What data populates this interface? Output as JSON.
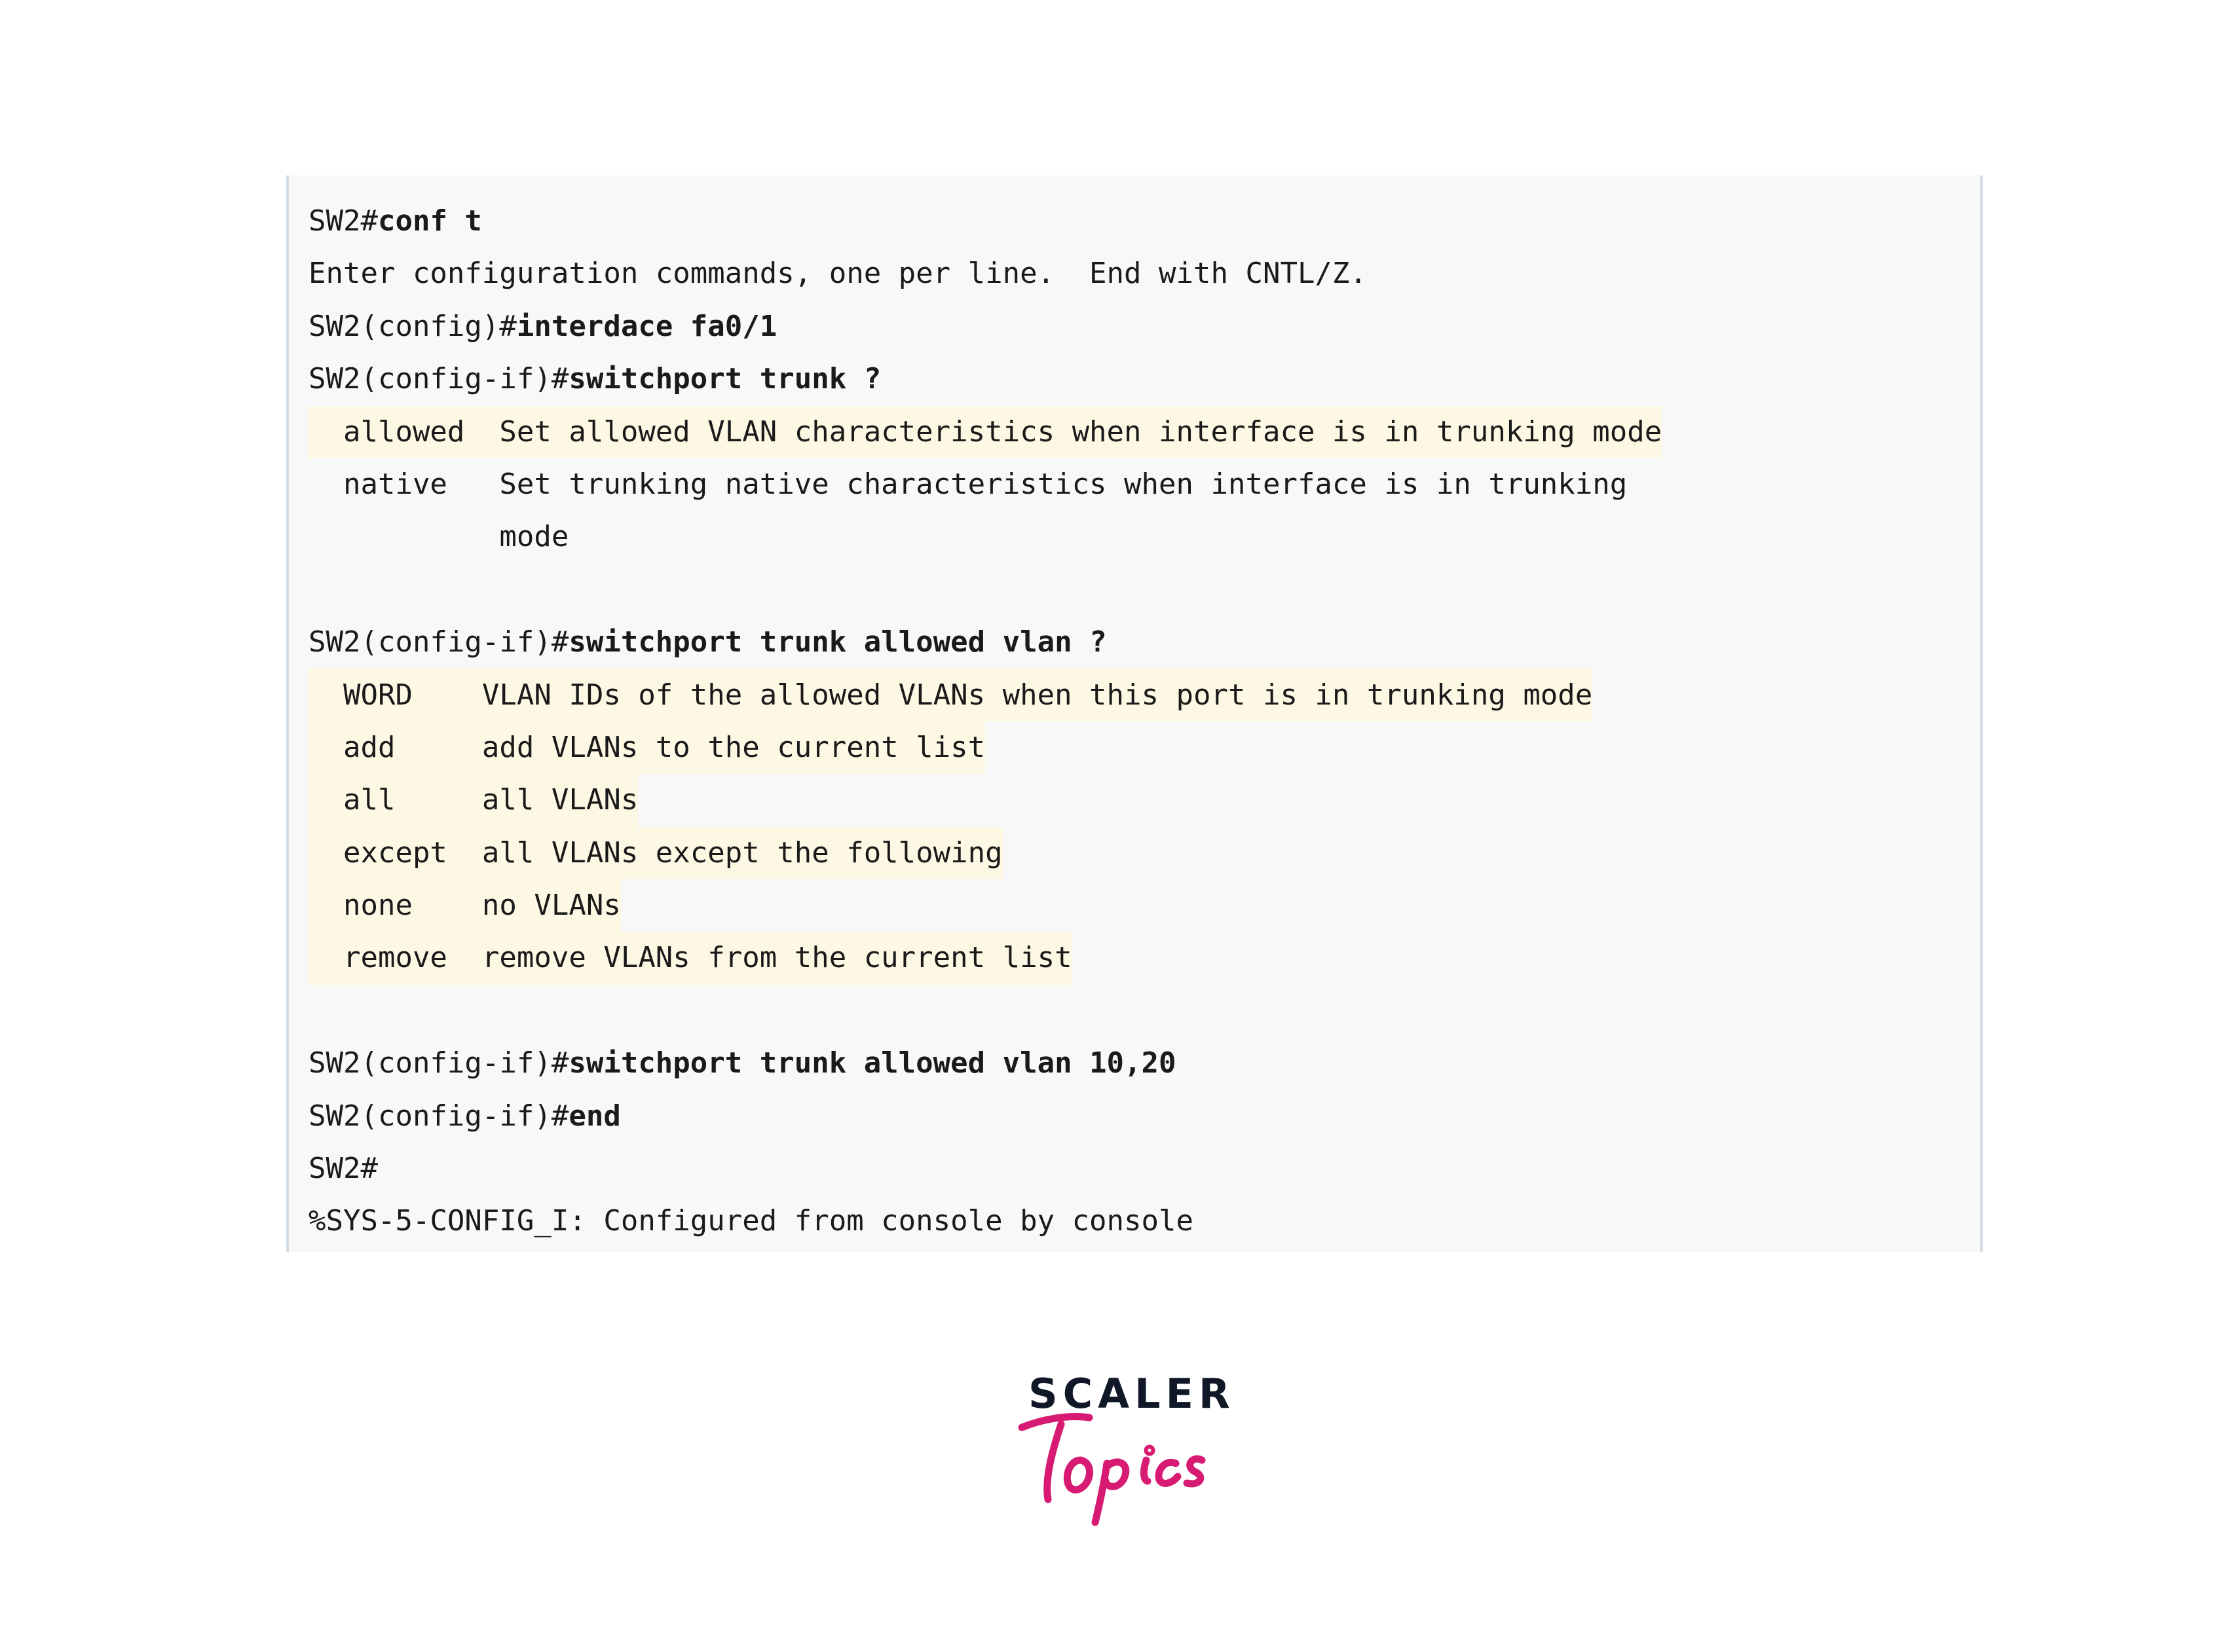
{
  "terminal": {
    "lines": [
      {
        "prompt": "SW2#",
        "command": "conf t"
      },
      {
        "output": "Enter configuration commands, one per line.  End with CNTL/Z."
      },
      {
        "prompt": "SW2(config)#",
        "command": "interdace fa0/1"
      },
      {
        "prompt": "SW2(config-if)#",
        "command": "switchport trunk ?"
      },
      {
        "help": "  allowed  Set allowed VLAN characteristics when interface is in trunking mode"
      },
      {
        "help2": "  native   Set trunking native characteristics when interface is in trunking"
      },
      {
        "help2": "           mode"
      },
      {
        "blank": ""
      },
      {
        "prompt": "SW2(config-if)#",
        "command": "switchport trunk allowed vlan ?"
      },
      {
        "help": "  WORD    VLAN IDs of the allowed VLANs when this port is in trunking mode"
      },
      {
        "help": "  add     add VLANs to the current list"
      },
      {
        "help": "  all     all VLANs"
      },
      {
        "help": "  except  all VLANs except the following"
      },
      {
        "help": "  none    no VLANs"
      },
      {
        "help": "  remove  remove VLANs from the current list"
      },
      {
        "blank": ""
      },
      {
        "prompt": "SW2(config-if)#",
        "command": "switchport trunk allowed vlan 10,20"
      },
      {
        "prompt": "SW2(config-if)#",
        "command": "end"
      },
      {
        "prompt": "SW2#",
        "command": ""
      },
      {
        "output": "%SYS-5-CONFIG_I: Configured from console by console"
      }
    ]
  },
  "logo": {
    "brand": "SCALER",
    "sub": "Topics",
    "brand_color": "#101828",
    "accent_color": "#d81b72"
  }
}
